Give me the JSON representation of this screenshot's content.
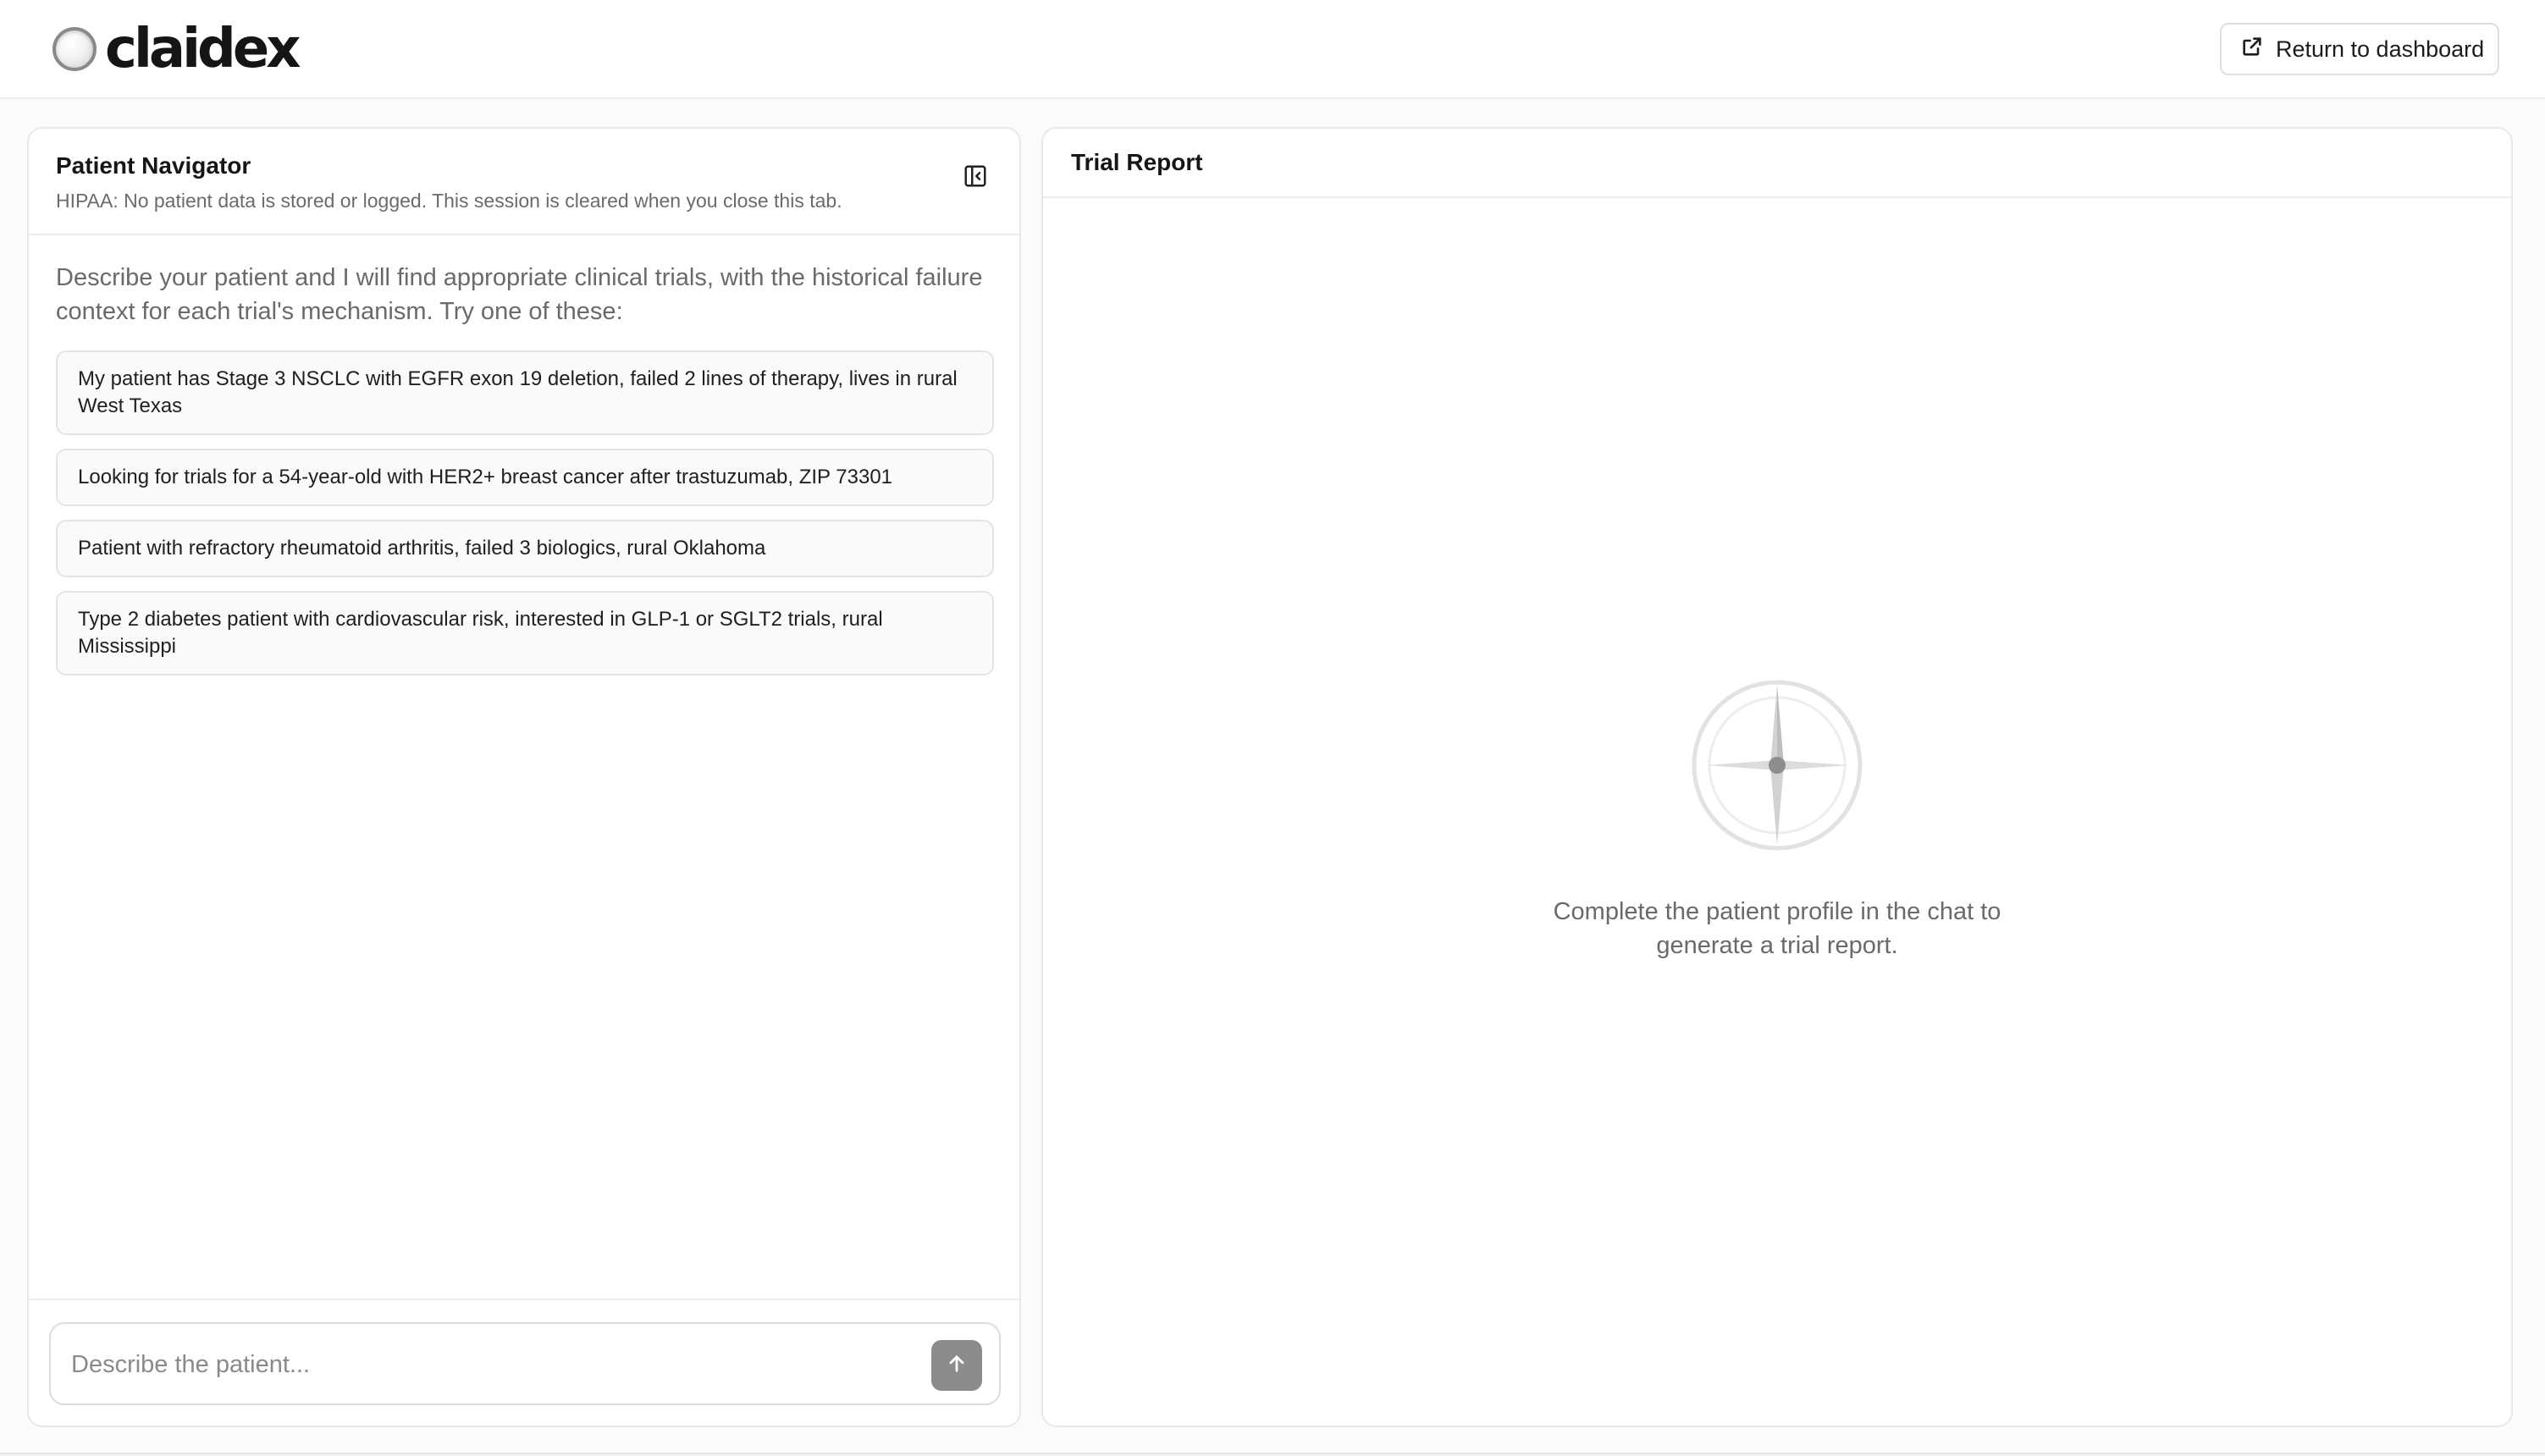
{
  "header": {
    "logo_text": "claidex",
    "return_label": "Return to dashboard",
    "return_icon": "external-link-icon"
  },
  "navigator": {
    "title": "Patient Navigator",
    "subtitle": "HIPAA: No patient data is stored or logged. This session is cleared when you close this tab.",
    "collapse_icon": "sidebar-collapse-icon",
    "intro": "Describe your patient and I will find appropriate clinical trials, with the historical failure context for each trial's mechanism. Try one of these:",
    "suggestions": [
      "My patient has Stage 3 NSCLC with EGFR exon 19 deletion, failed 2 lines of therapy, lives in rural West Texas",
      "Looking for trials for a 54-year-old with HER2+ breast cancer after trastuzumab, ZIP 73301",
      "Patient with refractory rheumatoid arthritis, failed 3 biologics, rural Oklahoma",
      "Type 2 diabetes patient with cardiovascular risk, interested in GLP-1 or SGLT2 trials, rural Mississippi"
    ],
    "input_placeholder": "Describe the patient...",
    "send_icon": "arrow-up-icon"
  },
  "report": {
    "title": "Trial Report",
    "empty_icon": "compass-icon",
    "empty_text": "Complete the patient profile in the chat to generate a trial report."
  },
  "colors": {
    "background": "#fbfbfb",
    "panel": "#ffffff",
    "border": "#e8e8e8",
    "muted_text": "#6a6a6a",
    "send_button": "#8c8c8c"
  }
}
